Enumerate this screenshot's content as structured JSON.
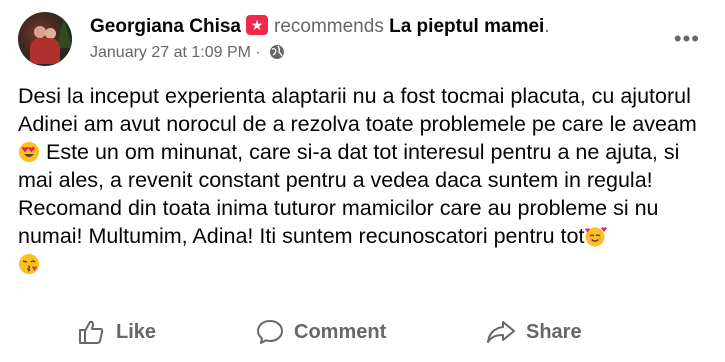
{
  "post": {
    "author": "Georgiana Chisa",
    "verb": "recommends",
    "page": "La pieptul mamei",
    "page_suffix": ".",
    "timestamp": "January 27 at 1:09 PM",
    "separator": "·",
    "privacy_icon": "globe-icon",
    "more_label": "•••",
    "text_part1": "Desi la inceput experienta alaptarii nu a fost tocmai placuta, cu ajutorul Adinei am avut norocul de a rezolva toate problemele pe care le aveam",
    "text_part2": " Este un om minunat, care si-a dat tot interesul pentru a ne ajuta, si mai ales, a revenit constant pentru a vedea daca suntem in regula! Recomand din toata inima tuturor mamicilor care au probleme si nu numai! Multumim, Adina! Iti suntem recunoscatori pentru tot",
    "emojis": [
      "heart-eyes-emoji",
      "smiling-face-with-hearts-emoji",
      "face-blowing-kiss-emoji"
    ]
  },
  "actions": {
    "like": "Like",
    "comment": "Comment",
    "share": "Share"
  },
  "colors": {
    "recommend_badge": "#f02849",
    "secondary_text": "#65676b",
    "primary_text": "#050505"
  }
}
